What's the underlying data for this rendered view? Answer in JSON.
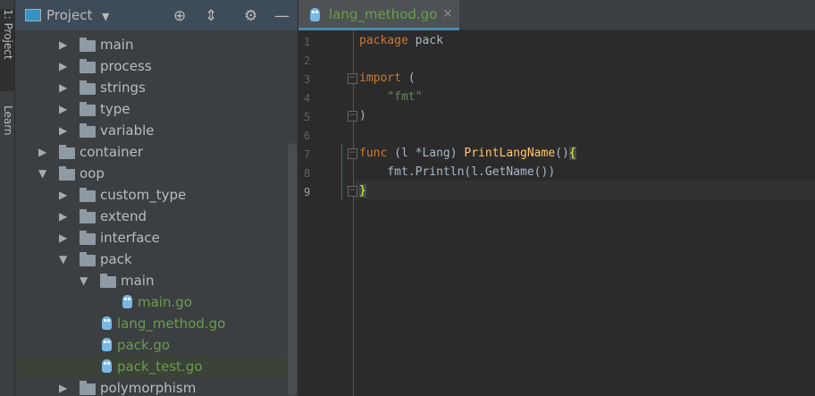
{
  "sidebar_tabs": {
    "project": "1: Project",
    "learn": "Learn"
  },
  "project_panel": {
    "title": "Project"
  },
  "tree": [
    {
      "label": "main",
      "type": "folder",
      "depth": 2,
      "expanded": false
    },
    {
      "label": "process",
      "type": "folder",
      "depth": 2,
      "expanded": false
    },
    {
      "label": "strings",
      "type": "folder",
      "depth": 2,
      "expanded": false
    },
    {
      "label": "type",
      "type": "folder",
      "depth": 2,
      "expanded": false
    },
    {
      "label": "variable",
      "type": "folder",
      "depth": 2,
      "expanded": false
    },
    {
      "label": "container",
      "type": "folder",
      "depth": 1,
      "expanded": false
    },
    {
      "label": "oop",
      "type": "folder",
      "depth": 1,
      "expanded": true
    },
    {
      "label": "custom_type",
      "type": "folder",
      "depth": 2,
      "expanded": false
    },
    {
      "label": "extend",
      "type": "folder",
      "depth": 2,
      "expanded": false
    },
    {
      "label": "interface",
      "type": "folder",
      "depth": 2,
      "expanded": false
    },
    {
      "label": "pack",
      "type": "folder",
      "depth": 2,
      "expanded": true
    },
    {
      "label": "main",
      "type": "folder",
      "depth": 3,
      "expanded": true
    },
    {
      "label": "main.go",
      "type": "file",
      "depth": 4
    },
    {
      "label": "lang_method.go",
      "type": "file",
      "depth": 3
    },
    {
      "label": "pack.go",
      "type": "file",
      "depth": 3
    },
    {
      "label": "pack_test.go",
      "type": "file",
      "depth": 3,
      "selected": true
    },
    {
      "label": "polymorphism",
      "type": "folder",
      "depth": 2,
      "expanded": false
    }
  ],
  "editor": {
    "tab_label": "lang_method.go",
    "current_line": 9,
    "lines": [
      "1",
      "2",
      "3",
      "4",
      "5",
      "6",
      "7",
      "8",
      "9"
    ],
    "code": {
      "l1a": "package",
      "l1b": " pack",
      "l3a": "import",
      "l3b": " (",
      "l4": "    \"fmt\"",
      "l5": ")",
      "l7a": "func",
      "l7b": " (l *Lang) ",
      "l7c": "PrintLangName",
      "l7d": "()",
      "l7e": "{",
      "l8": "    fmt.Println(l.GetName())",
      "l9": "}"
    }
  }
}
